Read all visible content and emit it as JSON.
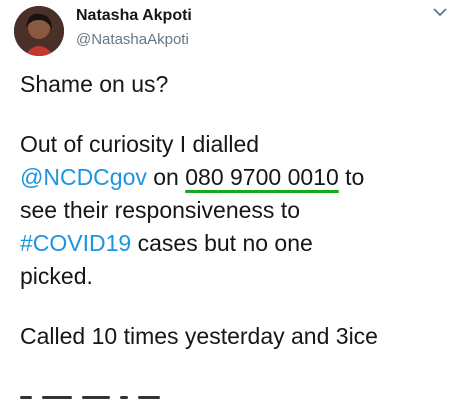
{
  "author": {
    "display_name": "Natasha Akpoti",
    "handle": "@NatashaAkpoti"
  },
  "tweet": {
    "p1": "Shame on us?",
    "p2_l1": "Out of curiosity I dialled",
    "p2_mention": "@NCDCgov",
    "p2_on": " on ",
    "p2_phone": "080 9700 0010",
    "p2_to": " to",
    "p2_l3": "see their responsiveness to",
    "p2_hashtag": "#COVID19",
    "p2_l4_rest": " cases but no one",
    "p2_l5": "picked.",
    "p3": "Called 10 times yesterday and 3ice"
  },
  "icons": {
    "menu": "chevron-down-icon"
  },
  "colors": {
    "link": "#1b95e0",
    "underline": "#19a71f",
    "handle": "#657786"
  }
}
